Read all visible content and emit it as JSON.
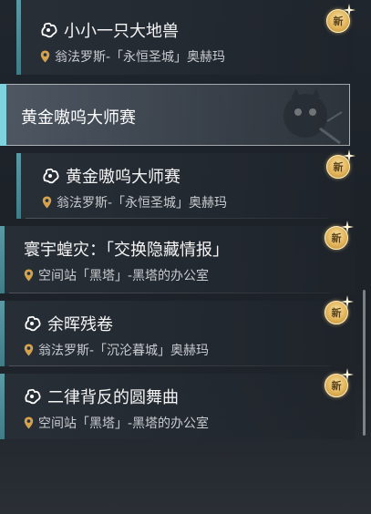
{
  "quests": [
    {
      "title": "小小一只大地兽",
      "location": "翁法罗斯-「永恒圣城」奥赫玛",
      "has_quest_icon": true,
      "badge": "新"
    },
    {
      "title": "黄金嗷呜大师赛",
      "location": "翁法罗斯-「永恒圣城」奥赫玛",
      "has_quest_icon": true,
      "badge": "新"
    },
    {
      "title": "寰宇蝗灾：「交换隐藏情报」",
      "location": "空间站「黑塔」-黑塔的办公室",
      "has_quest_icon": false,
      "badge": "新"
    },
    {
      "title": "余晖残卷",
      "location": "翁法罗斯-「沉沦暮城」奥赫玛",
      "has_quest_icon": true,
      "badge": "新"
    },
    {
      "title": "二律背反的圆舞曲",
      "location": "空间站「黑塔」-黑塔的办公室",
      "has_quest_icon": true,
      "badge": "新"
    }
  ],
  "selected_group": {
    "title": "黄金嗷呜大师赛"
  },
  "colors": {
    "accent_bar": "#4f8c96",
    "selected_bar": "#7fd3df",
    "badge_gold": "#e2b45a"
  },
  "icons": {
    "quest": "quest-puzzle-icon",
    "location": "location-pin-icon",
    "new": "new-badge-icon"
  }
}
